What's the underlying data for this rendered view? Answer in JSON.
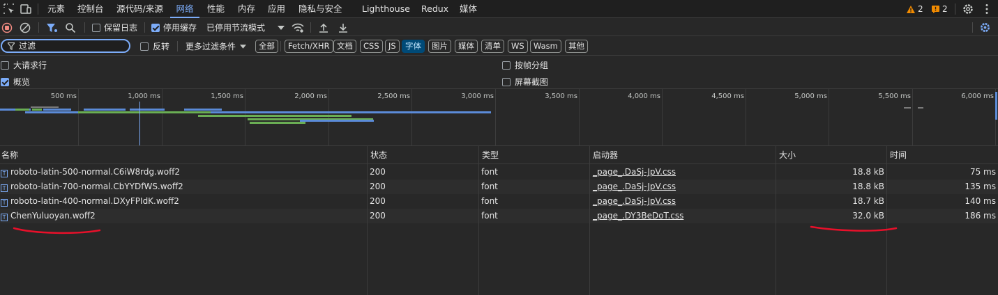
{
  "tabs": [
    "元素",
    "控制台",
    "源代码/来源",
    "网络",
    "性能",
    "内存",
    "应用",
    "隐私与安全",
    "Lighthouse",
    "Redux",
    "媒体"
  ],
  "badges": {
    "warnings": "2",
    "issues": "2"
  },
  "toolbar": {
    "preserve_log": "保留日志",
    "disable_cache": "停用缓存",
    "throttle": "已停用节流模式"
  },
  "filter": {
    "placeholder": "过滤",
    "invert": "反转",
    "more_filters": "更多过滤条件",
    "chips": [
      "全部",
      "Fetch/XHR",
      "文档",
      "CSS",
      "JS",
      "字体",
      "图片",
      "媒体",
      "清单",
      "WS",
      "Wasm",
      "其他"
    ],
    "active_chip": "字体"
  },
  "options": {
    "big_rows": "大请求行",
    "overview": "概览",
    "group_by_frame": "按帧分组",
    "screenshots": "屏幕截图"
  },
  "overview_ticks": [
    "500 ms",
    "1,000 ms",
    "1,500 ms",
    "2,000 ms",
    "2,500 ms",
    "3,000 ms",
    "3,500 ms",
    "4,000 ms",
    "4,500 ms",
    "5,000 ms",
    "5,500 ms",
    "6,000 ms"
  ],
  "columns": [
    "名称",
    "状态",
    "类型",
    "启动器",
    "大小",
    "时间"
  ],
  "rows": [
    {
      "name": "roboto-latin-500-normal.C6iW8rdg.woff2",
      "status": "200",
      "type": "font",
      "initiator": "_page_.DaSj-JpV.css",
      "size": "18.8 kB",
      "time": "75 ms"
    },
    {
      "name": "roboto-latin-700-normal.CbYYDfWS.woff2",
      "status": "200",
      "type": "font",
      "initiator": "_page_.DaSj-JpV.css",
      "size": "18.8 kB",
      "time": "135 ms"
    },
    {
      "name": "roboto-latin-400-normal.DXyFPIdK.woff2",
      "status": "200",
      "type": "font",
      "initiator": "_page_.DaSj-JpV.css",
      "size": "18.7 kB",
      "time": "140 ms"
    },
    {
      "name": "ChenYuluoyan.woff2",
      "status": "200",
      "type": "font",
      "initiator": "_page_.DY3BeDoT.css",
      "size": "32.0 kB",
      "time": "186 ms"
    }
  ],
  "colors": {
    "accent": "#7cacf8",
    "annotation": "#e8102a",
    "warning": "#f28b00"
  }
}
